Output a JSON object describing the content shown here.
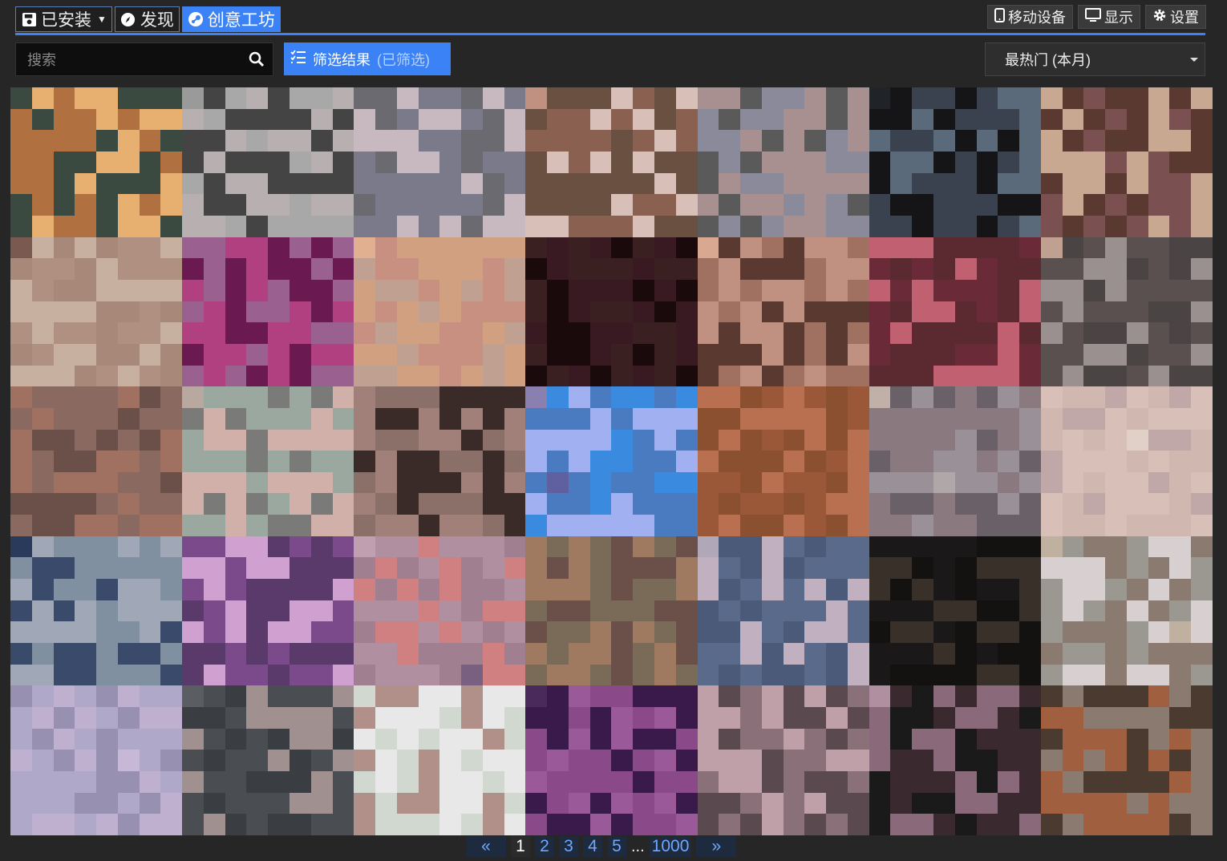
{
  "tabs": [
    {
      "label": "已安装",
      "icon": "save-icon",
      "active": false,
      "dropdown": true
    },
    {
      "label": "发现",
      "icon": "compass-icon",
      "active": false
    },
    {
      "label": "创意工坊",
      "icon": "steam-icon",
      "active": true
    }
  ],
  "right_buttons": [
    {
      "label": "移动设备",
      "icon": "mobile-icon"
    },
    {
      "label": "显示",
      "icon": "monitor-icon"
    },
    {
      "label": "设置",
      "icon": "gear-icon"
    }
  ],
  "search": {
    "placeholder": "搜索",
    "value": ""
  },
  "filter": {
    "label": "筛选结果",
    "status": "(已筛选)"
  },
  "sort": {
    "selected": "最热门 (本月)"
  },
  "pagination": {
    "prev": "«",
    "pages": [
      "1",
      "2",
      "3",
      "4",
      "5"
    ],
    "ellipsis": "...",
    "last": "1000",
    "next": "»",
    "current": "1"
  },
  "colors": {
    "accent": "#3b82f6",
    "background": "#262626"
  },
  "tiles": [
    {
      "palette": [
        "#3a4a40",
        "#6a5a40",
        "#b07040",
        "#555040",
        "#e8b070",
        "#4a4a3a"
      ]
    },
    {
      "palette": [
        "#a8a8a8",
        "#c0a8a8",
        "#b8b0b0",
        "#9a9a9a",
        "#444444",
        "#6a6a6a"
      ]
    },
    {
      "palette": [
        "#7a7a8a",
        "#b0a0b0",
        "#c8b8c0",
        "#9090a0",
        "#6a6a70",
        "#a8a0a8"
      ]
    },
    {
      "palette": [
        "#d8c0b8",
        "#c09080",
        "#8a6050",
        "#b8a090",
        "#6a5040",
        "#a08070"
      ]
    },
    {
      "palette": [
        "#8a8a9a",
        "#c0b8c8",
        "#a89090",
        "#b8a0a0",
        "#5a5a5a",
        "#9a8080"
      ]
    },
    {
      "palette": [
        "#151518",
        "#1a1a20",
        "#3a4250",
        "#283038",
        "#5a6a7a",
        "#202428"
      ]
    },
    {
      "palette": [
        "#c8a890",
        "#b89080",
        "#5a3a30",
        "#8a6a60",
        "#7a5050",
        "#a08070"
      ]
    },
    {
      "palette": [
        "#c8b0a0",
        "#d0c0b0",
        "#a88878",
        "#7a5a50",
        "#b09080",
        "#5a4a40"
      ]
    },
    {
      "palette": [
        "#6a1a50",
        "#8a2070",
        "#b04080",
        "#4a1a40",
        "#9a6090",
        "#3a1a30"
      ]
    },
    {
      "palette": [
        "#c89080",
        "#e0b090",
        "#d0a080",
        "#8a6050",
        "#c0a090",
        "#4a3a38"
      ]
    },
    {
      "palette": [
        "#3a1a22",
        "#2a1418",
        "#1a0a0c",
        "#4a2a2a",
        "#3a2020",
        "#22121a"
      ]
    },
    {
      "palette": [
        "#c09080",
        "#e0b8a0",
        "#a07060",
        "#8a5a4a",
        "#5a3a30",
        "#d8a890"
      ]
    },
    {
      "palette": [
        "#6a2a38",
        "#9a3040",
        "#c06070",
        "#e0a0a8",
        "#5a2a30",
        "#a03a48"
      ]
    },
    {
      "palette": [
        "#5a5050",
        "#7a6a68",
        "#9a9090",
        "#c0a090",
        "#4a4444",
        "#8a7a78"
      ]
    },
    {
      "palette": [
        "#a07060",
        "#c09080",
        "#8a6a60",
        "#b08070",
        "#6a5048",
        "#e0a070"
      ]
    },
    {
      "palette": [
        "#9aa8a0",
        "#b8a8a0",
        "#d0b0a8",
        "#f0c0c0",
        "#7a7a78",
        "#a09890"
      ]
    },
    {
      "palette": [
        "#3a2a28",
        "#5a4a48",
        "#8a7068",
        "#2a1a18",
        "#a08078",
        "#4a3a38"
      ]
    },
    {
      "palette": [
        "#4a7ac0",
        "#7a9ae0",
        "#3a8ae0",
        "#6060a0",
        "#a0b0f0",
        "#8a80b0"
      ]
    },
    {
      "palette": [
        "#8a5030",
        "#a06040",
        "#b87050",
        "#7a4028",
        "#9a5838",
        "#c08060"
      ]
    },
    {
      "palette": [
        "#9a9098",
        "#b0a8a8",
        "#6a6068",
        "#c0b0a8",
        "#8a7a80",
        "#a09898"
      ]
    },
    {
      "palette": [
        "#d8c0b8",
        "#e0d0c8",
        "#c0a8a8",
        "#b8a0a8",
        "#d0b8b0",
        "#a89098"
      ]
    },
    {
      "palette": [
        "#3a4a6a",
        "#5a6a8a",
        "#8090a0",
        "#2a3a5a",
        "#a0a8b8",
        "#4a5a7a"
      ]
    },
    {
      "palette": [
        "#5a3a6a",
        "#a070b0",
        "#d0a0d0",
        "#3a2a4a",
        "#7a4a8a",
        "#c080c0"
      ]
    },
    {
      "palette": [
        "#a08090",
        "#c0a0b0",
        "#d08080",
        "#8080a0",
        "#b090a0",
        "#7a6080"
      ]
    },
    {
      "palette": [
        "#6a5048",
        "#8a6a58",
        "#a07a60",
        "#5a4038",
        "#7a6a58",
        "#4a3a30"
      ]
    },
    {
      "palette": [
        "#5a6a8a",
        "#7a8aa0",
        "#c0b0c0",
        "#9aa0b0",
        "#4a5a78",
        "#b0a8b8"
      ]
    },
    {
      "palette": [
        "#1a1818",
        "#2a2420",
        "#3a302a",
        "#d0b0a0",
        "#141210",
        "#5a4840"
      ]
    },
    {
      "palette": [
        "#9a9890",
        "#a89080",
        "#8a7a70",
        "#c0b0a0",
        "#d8d0d0",
        "#6a6058"
      ]
    },
    {
      "palette": [
        "#c0b0d0",
        "#a8a0c0",
        "#b0a8c8",
        "#d0c0d8",
        "#9890b0",
        "#c8b8d8"
      ]
    },
    {
      "palette": [
        "#4a4e52",
        "#5a5e62",
        "#3a3e42",
        "#6a6e72",
        "#a09090",
        "#505458"
      ]
    },
    {
      "palette": [
        "#e8e8e8",
        "#a09090",
        "#d0d8d0",
        "#806058",
        "#b09088",
        "#c8a090"
      ]
    },
    {
      "palette": [
        "#3a1a4a",
        "#6a3a7a",
        "#9a5a9a",
        "#2a1a38",
        "#8a4a8a",
        "#4a2a5a"
      ]
    },
    {
      "palette": [
        "#5a4a50",
        "#7a6a70",
        "#c0a0a8",
        "#e0c0c0",
        "#8a7078",
        "#4a3a40"
      ]
    },
    {
      "palette": [
        "#1a1a1a",
        "#2a2a2a",
        "#8a6a7a",
        "#b090a0",
        "#3a2a30",
        "#201818"
      ]
    },
    {
      "palette": [
        "#4a3a30",
        "#6a5a50",
        "#8a7a70",
        "#b09090",
        "#a06040",
        "#3a2a20"
      ]
    }
  ]
}
